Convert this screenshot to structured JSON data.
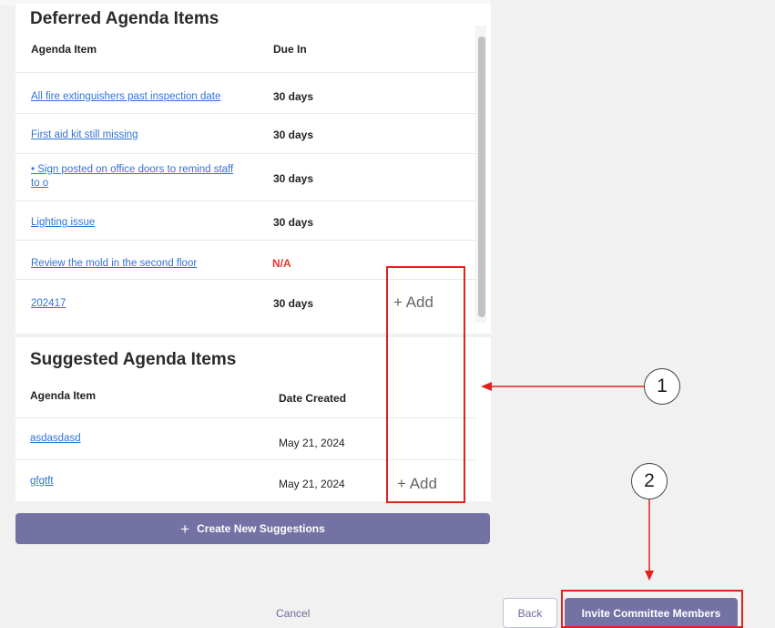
{
  "deferred": {
    "title": "Deferred Agenda Items",
    "col_item": "Agenda Item",
    "col_due": "Due In",
    "rows": [
      {
        "item": "All fire extinguishers past inspection date",
        "due": "30 days"
      },
      {
        "item": "First aid kit still missing",
        "due": "30 days"
      },
      {
        "item_line1": "• Sign posted on office doors to remind staff",
        "item_line2": "to o",
        "due": "30 days"
      },
      {
        "item": "Lighting issue",
        "due": "30 days"
      },
      {
        "item": "Review the mold in the second floor",
        "due": "N/A"
      },
      {
        "item": "202417",
        "due": "30 days",
        "add": "+ Add"
      }
    ]
  },
  "suggested": {
    "title": "Suggested Agenda Items",
    "col_item": "Agenda Item",
    "col_date": "Date Created",
    "rows": [
      {
        "item": "asdasdasd",
        "date": "May 21, 2024"
      },
      {
        "item": "gfgtft",
        "date": "May 21, 2024",
        "add": "+ Add"
      }
    ]
  },
  "create_button": {
    "icon": "+",
    "label": "Create New Suggestions"
  },
  "footer": {
    "cancel": "Cancel",
    "back": "Back",
    "invite": "Invite Committee Members"
  },
  "annotations": {
    "callout_1": "1",
    "callout_2": "2",
    "highlight_color": "#e0221d"
  },
  "colors": {
    "link": "#2f73d6",
    "accent": "#7472a5",
    "warning": "#e53935"
  }
}
